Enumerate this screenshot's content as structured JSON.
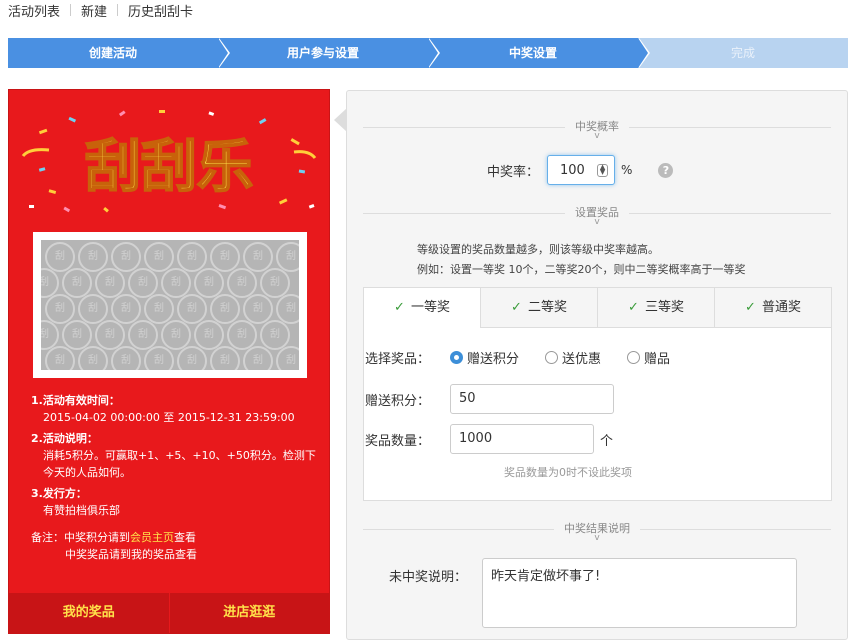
{
  "nav": {
    "items": [
      "活动列表",
      "新建",
      "历史刮刮卡"
    ]
  },
  "steps": [
    {
      "label": "创建活动",
      "state": "active"
    },
    {
      "label": "用户参与设置",
      "state": "active"
    },
    {
      "label": "中奖设置",
      "state": "active"
    },
    {
      "label": "完成",
      "state": "pending"
    }
  ],
  "preview": {
    "banner_title": "刮刮乐",
    "coin_char": "刮",
    "time_heading": "1.活动有效时间：",
    "time_value": "2015-04-02 00:00:00 至 2015-12-31 23:59:00",
    "desc_heading": "2.活动说明：",
    "desc_value": "消耗5积分。可赢取+1、+5、+10、+50积分。检测下今天的人品如何。",
    "issuer_heading": "3.发行方：",
    "issuer_value": "有赞拍档俱乐部",
    "remark_prefix": "备注：",
    "remark_line1_a": "中奖积分请到",
    "remark_line1_link": "会员主页",
    "remark_line1_b": "查看",
    "remark_line2": "中奖奖品请到我的奖品查看",
    "btn_prizes": "我的奖品",
    "btn_shop": "进店逛逛"
  },
  "settings": {
    "section_rate": "中奖概率",
    "rate_label": "中奖率：",
    "rate_value": "100",
    "rate_unit": "%",
    "help_glyph": "?",
    "section_prize": "设置奖品",
    "note1": "等级设置的奖品数量越多，则该等级中奖率越高。",
    "note2": "例如：设置一等奖 10个，二等奖20个，则中二等奖概率高于一等奖",
    "tabs": [
      "一等奖",
      "二等奖",
      "三等奖",
      "普通奖"
    ],
    "select_label": "选择奖品：",
    "options": [
      "赠送积分",
      "送优惠",
      "赠品"
    ],
    "points_label": "赠送积分：",
    "points_value": "50",
    "qty_label": "奖品数量：",
    "qty_value": "1000",
    "qty_unit": "个",
    "qty_hint": "奖品数量为0时不设此奖项",
    "section_result": "中奖结果说明",
    "no_win_label": "未中奖说明：",
    "no_win_value": "昨天肯定做坏事了!"
  },
  "colors": {
    "accent": "#4a90e2",
    "step_pending": "#b8d3f0",
    "card_red": "#e8191c",
    "highlight": "#ffe14a"
  }
}
